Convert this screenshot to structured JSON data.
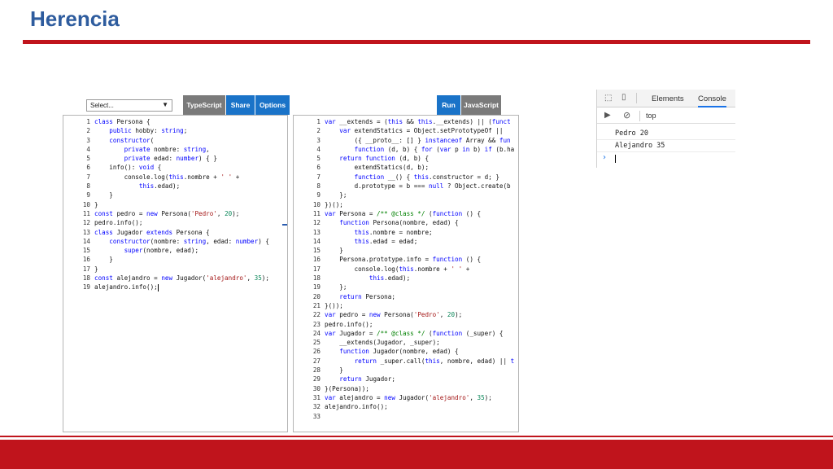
{
  "slide": {
    "title": "Herencia"
  },
  "playground": {
    "select_value": "Select...",
    "buttons": {
      "typescript": "TypeScript",
      "share": "Share",
      "options": "Options",
      "run": "Run",
      "javascript": "JavaScript"
    }
  },
  "ts_code": [
    [
      [
        "class ",
        "kw"
      ],
      [
        "Persona {",
        ""
      ]
    ],
    [
      [
        "    ",
        ""
      ],
      [
        "public ",
        "kw"
      ],
      [
        "hobby: ",
        ""
      ],
      [
        "string",
        "kw"
      ],
      [
        ";",
        ""
      ]
    ],
    [
      [
        "    ",
        ""
      ],
      [
        "constructor",
        "kw"
      ],
      [
        "(",
        ""
      ]
    ],
    [
      [
        "        ",
        ""
      ],
      [
        "private ",
        "kw"
      ],
      [
        "nombre: ",
        ""
      ],
      [
        "string",
        "kw"
      ],
      [
        ",",
        ""
      ]
    ],
    [
      [
        "        ",
        ""
      ],
      [
        "private ",
        "kw"
      ],
      [
        "edad: ",
        ""
      ],
      [
        "number",
        "kw"
      ],
      [
        ") { }",
        ""
      ]
    ],
    [
      [
        "    info(): ",
        ""
      ],
      [
        "void",
        "kw"
      ],
      [
        " {",
        ""
      ]
    ],
    [
      [
        "        console.log(",
        ""
      ],
      [
        "this",
        "kw"
      ],
      [
        ".nombre + ",
        ""
      ],
      [
        "' '",
        "str"
      ],
      [
        " +",
        ""
      ]
    ],
    [
      [
        "            ",
        ""
      ],
      [
        "this",
        "kw"
      ],
      [
        ".edad);",
        ""
      ]
    ],
    [
      [
        "    }",
        ""
      ]
    ],
    [
      [
        "}",
        ""
      ]
    ],
    [
      [
        "const ",
        "kw"
      ],
      [
        "pedro = ",
        ""
      ],
      [
        "new ",
        "kw"
      ],
      [
        "Persona(",
        ""
      ],
      [
        "'Pedro'",
        "str"
      ],
      [
        ", ",
        ""
      ],
      [
        "20",
        "num"
      ],
      [
        ");",
        ""
      ]
    ],
    [
      [
        "pedro.info();",
        ""
      ]
    ],
    [
      [
        "class ",
        "kw"
      ],
      [
        "Jugador ",
        ""
      ],
      [
        "extends ",
        "kw"
      ],
      [
        "Persona {",
        ""
      ]
    ],
    [
      [
        "    ",
        ""
      ],
      [
        "constructor",
        "kw"
      ],
      [
        "(nombre: ",
        ""
      ],
      [
        "string",
        "kw"
      ],
      [
        ", edad: ",
        ""
      ],
      [
        "number",
        "kw"
      ],
      [
        ") {",
        ""
      ]
    ],
    [
      [
        "        ",
        ""
      ],
      [
        "super",
        "kw"
      ],
      [
        "(nombre, edad);",
        ""
      ]
    ],
    [
      [
        "    }",
        ""
      ]
    ],
    [
      [
        "}",
        ""
      ]
    ],
    [
      [
        "const ",
        "kw"
      ],
      [
        "alejandro = ",
        ""
      ],
      [
        "new ",
        "kw"
      ],
      [
        "Jugador(",
        ""
      ],
      [
        "'alejandro'",
        "str"
      ],
      [
        ", ",
        ""
      ],
      [
        "35",
        "num"
      ],
      [
        ");",
        ""
      ]
    ],
    [
      [
        "alejandro.info();",
        ""
      ]
    ]
  ],
  "js_code": [
    [
      [
        "var ",
        "kw"
      ],
      [
        "__extends = (",
        ""
      ],
      [
        "this",
        "kw"
      ],
      [
        " && ",
        ""
      ],
      [
        "this",
        "kw"
      ],
      [
        ".__extends) || (",
        ""
      ],
      [
        "funct",
        "kw"
      ]
    ],
    [
      [
        "    ",
        ""
      ],
      [
        "var ",
        "kw"
      ],
      [
        "extendStatics = Object.setPrototypeOf ||",
        ""
      ]
    ],
    [
      [
        "        ({ __proto__: [] } ",
        ""
      ],
      [
        "instanceof ",
        "kw"
      ],
      [
        "Array && ",
        ""
      ],
      [
        "fun",
        "kw"
      ]
    ],
    [
      [
        "        ",
        ""
      ],
      [
        "function ",
        "kw"
      ],
      [
        "(d, b) { ",
        ""
      ],
      [
        "for ",
        "kw"
      ],
      [
        "(",
        ""
      ],
      [
        "var ",
        "kw"
      ],
      [
        "p ",
        ""
      ],
      [
        "in ",
        "kw"
      ],
      [
        "b) ",
        ""
      ],
      [
        "if ",
        "kw"
      ],
      [
        "(b.ha",
        ""
      ]
    ],
    [
      [
        "    ",
        ""
      ],
      [
        "return function ",
        "kw"
      ],
      [
        "(d, b) {",
        ""
      ]
    ],
    [
      [
        "        extendStatics(d, b);",
        ""
      ]
    ],
    [
      [
        "        ",
        ""
      ],
      [
        "function ",
        "kw"
      ],
      [
        "__() { ",
        ""
      ],
      [
        "this",
        "kw"
      ],
      [
        ".constructor = d; }",
        ""
      ]
    ],
    [
      [
        "        d.prototype = b === ",
        ""
      ],
      [
        "null ",
        "kw"
      ],
      [
        "? Object.create(b",
        ""
      ]
    ],
    [
      [
        "    };",
        ""
      ]
    ],
    [
      [
        "})();",
        ""
      ]
    ],
    [
      [
        "var ",
        "kw"
      ],
      [
        "Persona = ",
        ""
      ],
      [
        "/** @class */ ",
        "cmt"
      ],
      [
        "(",
        ""
      ],
      [
        "function ",
        "kw"
      ],
      [
        "() {",
        ""
      ]
    ],
    [
      [
        "    ",
        ""
      ],
      [
        "function ",
        "kw"
      ],
      [
        "Persona(nombre, edad) {",
        ""
      ]
    ],
    [
      [
        "        ",
        ""
      ],
      [
        "this",
        "kw"
      ],
      [
        ".nombre = nombre;",
        ""
      ]
    ],
    [
      [
        "        ",
        ""
      ],
      [
        "this",
        "kw"
      ],
      [
        ".edad = edad;",
        ""
      ]
    ],
    [
      [
        "    }",
        ""
      ]
    ],
    [
      [
        "    Persona.prototype.info = ",
        ""
      ],
      [
        "function ",
        "kw"
      ],
      [
        "() {",
        ""
      ]
    ],
    [
      [
        "        console.log(",
        ""
      ],
      [
        "this",
        "kw"
      ],
      [
        ".nombre + ",
        ""
      ],
      [
        "' '",
        "str"
      ],
      [
        " +",
        ""
      ]
    ],
    [
      [
        "            ",
        ""
      ],
      [
        "this",
        "kw"
      ],
      [
        ".edad);",
        ""
      ]
    ],
    [
      [
        "    };",
        ""
      ]
    ],
    [
      [
        "    ",
        ""
      ],
      [
        "return ",
        "kw"
      ],
      [
        "Persona;",
        ""
      ]
    ],
    [
      [
        "}());",
        ""
      ]
    ],
    [
      [
        "var ",
        "kw"
      ],
      [
        "pedro = ",
        ""
      ],
      [
        "new ",
        "kw"
      ],
      [
        "Persona(",
        ""
      ],
      [
        "'Pedro'",
        "str"
      ],
      [
        ", ",
        ""
      ],
      [
        "20",
        "num"
      ],
      [
        ");",
        ""
      ]
    ],
    [
      [
        "pedro.info();",
        ""
      ]
    ],
    [
      [
        "var ",
        "kw"
      ],
      [
        "Jugador = ",
        ""
      ],
      [
        "/** @class */ ",
        "cmt"
      ],
      [
        "(",
        ""
      ],
      [
        "function ",
        "kw"
      ],
      [
        "(_super) {",
        ""
      ]
    ],
    [
      [
        "    __extends(Jugador, _super);",
        ""
      ]
    ],
    [
      [
        "    ",
        ""
      ],
      [
        "function ",
        "kw"
      ],
      [
        "Jugador(nombre, edad) {",
        ""
      ]
    ],
    [
      [
        "        ",
        ""
      ],
      [
        "return ",
        "kw"
      ],
      [
        "_super.call(",
        ""
      ],
      [
        "this",
        "kw"
      ],
      [
        ", nombre, edad) || ",
        ""
      ],
      [
        "t",
        "kw"
      ]
    ],
    [
      [
        "    }",
        ""
      ]
    ],
    [
      [
        "    ",
        ""
      ],
      [
        "return ",
        "kw"
      ],
      [
        "Jugador;",
        ""
      ]
    ],
    [
      [
        "}(Persona));",
        ""
      ]
    ],
    [
      [
        "var ",
        "kw"
      ],
      [
        "alejandro = ",
        ""
      ],
      [
        "new ",
        "kw"
      ],
      [
        "Jugador(",
        ""
      ],
      [
        "'alejandro'",
        "str"
      ],
      [
        ", ",
        ""
      ],
      [
        "35",
        "num"
      ],
      [
        ");",
        ""
      ]
    ],
    [
      [
        "alejandro.info();",
        ""
      ]
    ],
    [
      [
        "",
        ""
      ]
    ]
  ],
  "devtools": {
    "tabs": [
      "Elements",
      "Console"
    ],
    "context": "top",
    "output": [
      "Pedro 20",
      "Alejandro 35"
    ],
    "prompt": "›"
  },
  "colors": {
    "accent_red": "#c0141c",
    "title_blue": "#2e5c9e",
    "button_blue": "#1a73c8",
    "button_gray": "#7a7a7a"
  }
}
